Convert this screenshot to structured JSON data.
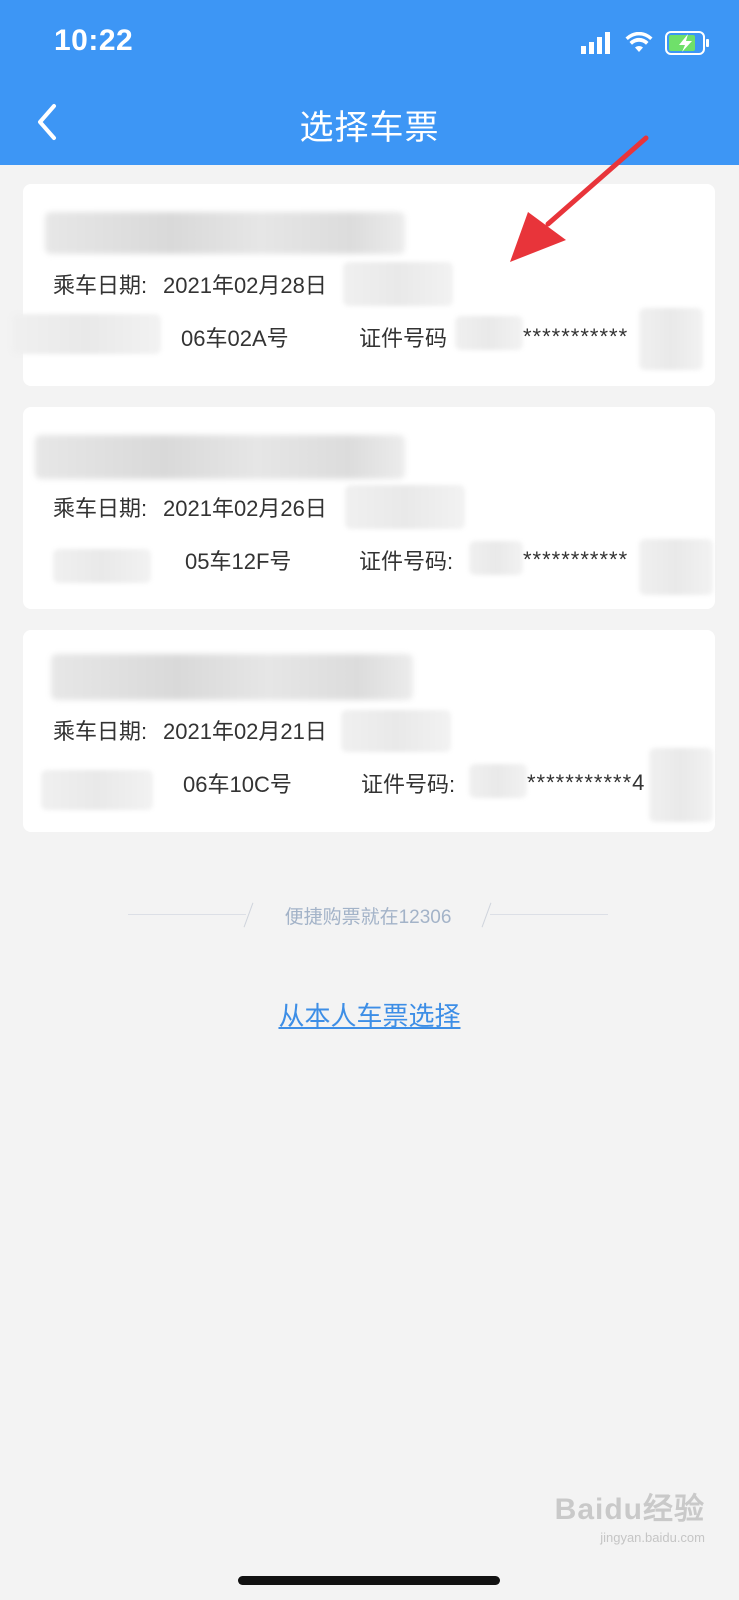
{
  "status_bar": {
    "time": "10:22"
  },
  "header": {
    "title": "选择车票"
  },
  "tickets": [
    {
      "date_label": "乘车日期:",
      "date_value": "2021年02月28日",
      "seat": "06车02A号",
      "id_label": "证件号码",
      "id_masked": "***********"
    },
    {
      "date_label": "乘车日期:",
      "date_value": "2021年02月26日",
      "seat": "05车12F号",
      "id_label": "证件号码:",
      "id_masked": "***********"
    },
    {
      "date_label": "乘车日期:",
      "date_value": "2021年02月21日",
      "seat": "06车10C号",
      "id_label": "证件号码:",
      "id_masked": "***********4"
    }
  ],
  "divider": {
    "text": "便捷购票就在12306"
  },
  "link": {
    "label": "从本人车票选择"
  },
  "watermark": {
    "brand": "Baidu经验",
    "url": "jingyan.baidu.com"
  },
  "colors": {
    "header": "#3d96f5",
    "link": "#3d8ee6",
    "annotation_arrow": "#e8343a",
    "background": "#f3f3f3"
  }
}
